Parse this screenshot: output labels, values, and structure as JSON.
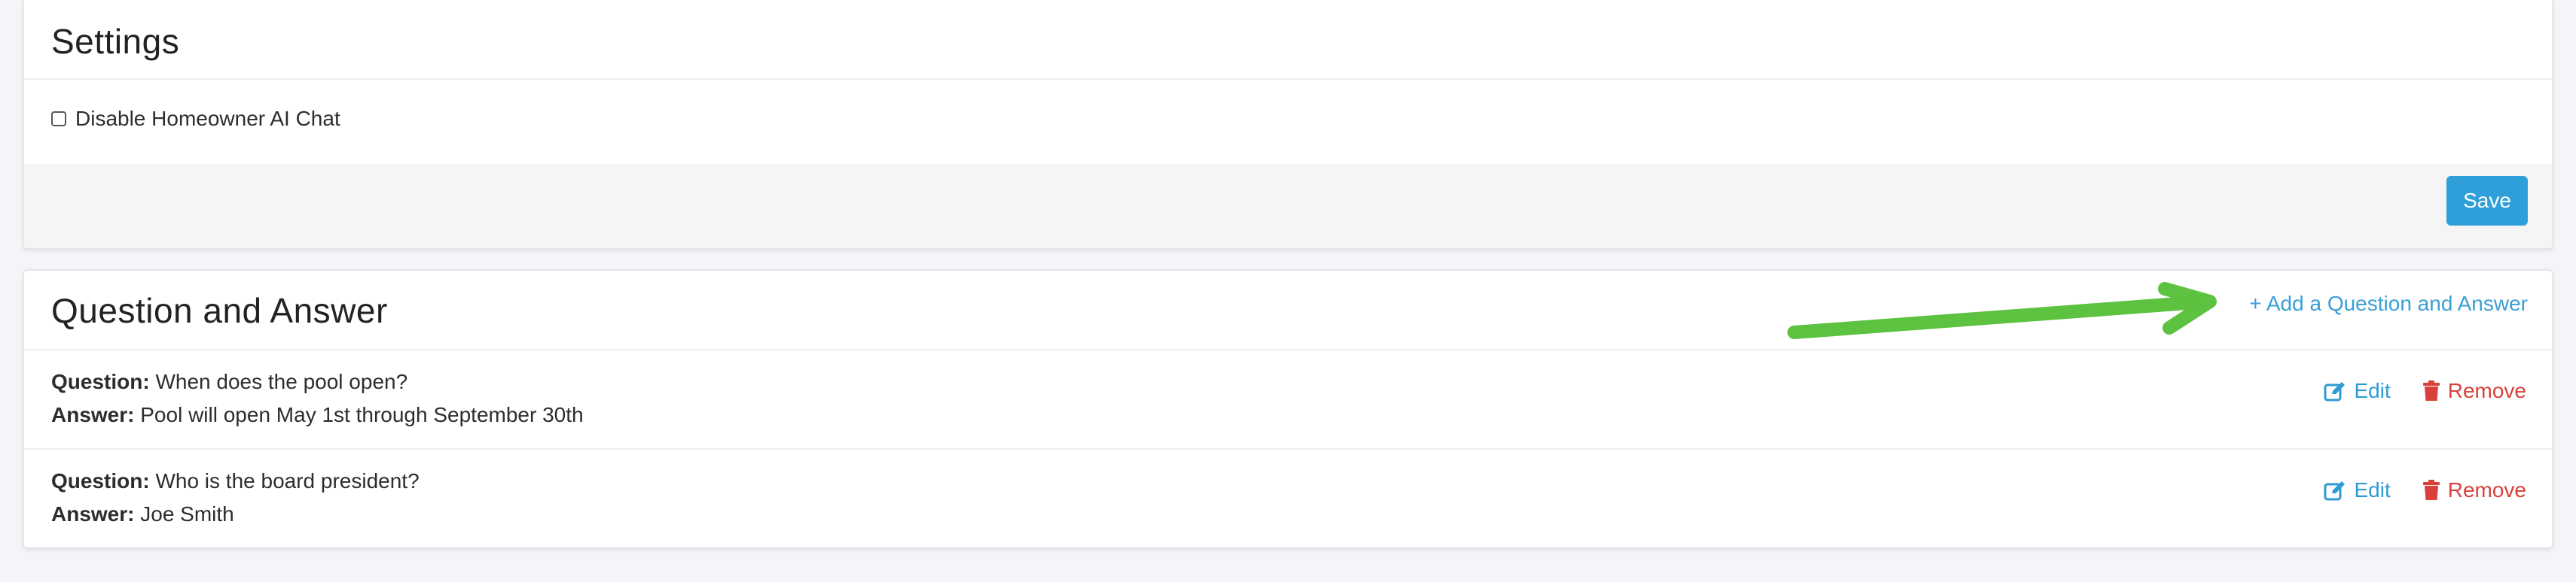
{
  "settings": {
    "title": "Settings",
    "checkbox_label": "Disable Homeowner AI Chat",
    "checkbox_checked": false,
    "save_label": "Save"
  },
  "qa": {
    "title": "Question and Answer",
    "add_link": "+ Add a Question and Answer",
    "items": [
      {
        "question_key": "Question:",
        "question": "When does the pool open?",
        "answer_key": "Answer:",
        "answer": "Pool will open May 1st through September 30th",
        "edit_label": "Edit",
        "remove_label": "Remove"
      },
      {
        "question_key": "Question:",
        "question": "Who is the board president?",
        "answer_key": "Answer:",
        "answer": "Joe Smith",
        "edit_label": "Edit",
        "remove_label": "Remove"
      }
    ]
  },
  "icons": {
    "edit": "edit-icon",
    "remove": "trash-icon",
    "annotation": "green-arrow"
  },
  "colors": {
    "accent": "#2f9fd9",
    "link": "#3a9fd6",
    "danger": "#d9403a",
    "annotation": "#5cc23f"
  }
}
